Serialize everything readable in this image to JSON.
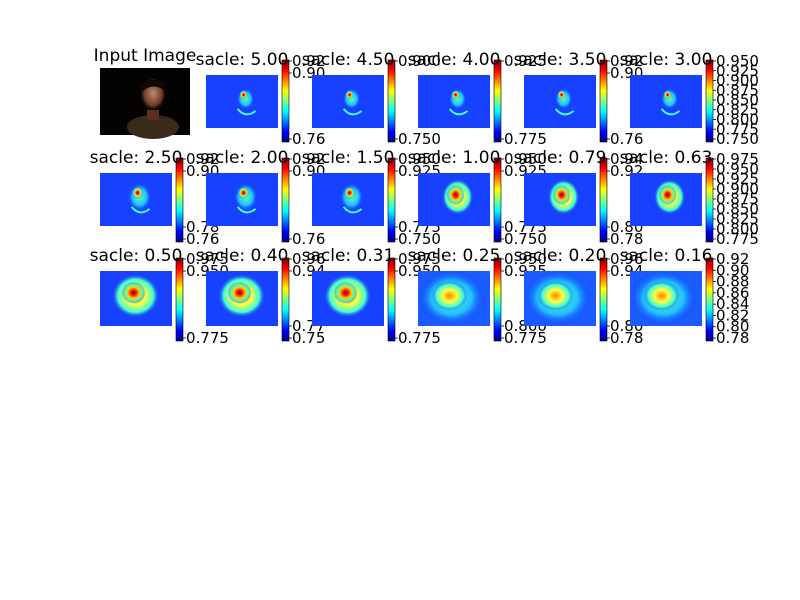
{
  "figure": {
    "input_title": "Input Image"
  },
  "colors": {
    "jet_low": "#00007f",
    "jet_mid": "#7fff7f",
    "jet_high": "#7f0000",
    "background": "#ffffff"
  },
  "chart_data": {
    "type": "heatmap",
    "colormap": "jet",
    "panels": [
      {
        "title": "sacle: 5.00",
        "cbar_ticks": [
          "0.92",
          "0.90",
          "0.76"
        ],
        "hotspot": "face-sparse"
      },
      {
        "title": "sacle: 4.50",
        "cbar_ticks": [
          "0.900",
          "0.750"
        ],
        "hotspot": "face-sparse"
      },
      {
        "title": "sacle: 4.00",
        "cbar_ticks": [
          "0.925",
          "0.775"
        ],
        "hotspot": "face-sparse"
      },
      {
        "title": "sacle: 3.50",
        "cbar_ticks": [
          "0.92",
          "0.90",
          "0.76"
        ],
        "hotspot": "face-sparse"
      },
      {
        "title": "sacle: 3.00",
        "cbar_ticks": [
          "0.950",
          "0.925",
          "0.900",
          "0.875",
          "0.850",
          "0.825",
          "0.800",
          "0.775",
          "0.750"
        ],
        "hotspot": "face-sparse"
      },
      {
        "title": "sacle: 2.50",
        "cbar_ticks": [
          "0.92",
          "0.90",
          "0.78",
          "0.76"
        ],
        "hotspot": "face-medium"
      },
      {
        "title": "sacle: 2.00",
        "cbar_ticks": [
          "0.92",
          "0.90",
          "0.76"
        ],
        "hotspot": "face-medium"
      },
      {
        "title": "sacle: 1.50",
        "cbar_ticks": [
          "0.950",
          "0.925",
          "0.775",
          "0.750"
        ],
        "hotspot": "face-medium"
      },
      {
        "title": "sacle: 1.00",
        "cbar_ticks": [
          "0.950",
          "0.925",
          "0.775",
          "0.750"
        ],
        "hotspot": "face-blob"
      },
      {
        "title": "sacle: 0.79",
        "cbar_ticks": [
          "0.94",
          "0.92",
          "0.80",
          "0.78"
        ],
        "hotspot": "face-blob"
      },
      {
        "title": "sacle: 0.63",
        "cbar_ticks": [
          "0.975",
          "0.950",
          "0.925",
          "0.900",
          "0.875",
          "0.850",
          "0.825",
          "0.800",
          "0.775"
        ],
        "hotspot": "face-blob"
      },
      {
        "title": "sacle: 0.50",
        "cbar_ticks": [
          "0.975",
          "0.950",
          "0.775"
        ],
        "hotspot": "blob-large"
      },
      {
        "title": "sacle: 0.40",
        "cbar_ticks": [
          "0.96",
          "0.94",
          "0.77",
          "0.75"
        ],
        "hotspot": "blob-large"
      },
      {
        "title": "sacle: 0.31",
        "cbar_ticks": [
          "0.975",
          "0.950",
          "0.775"
        ],
        "hotspot": "blob-large"
      },
      {
        "title": "sacle: 0.25",
        "cbar_ticks": [
          "0.950",
          "0.925",
          "0.800",
          "0.775"
        ],
        "hotspot": "blob-diffuse"
      },
      {
        "title": "sacle: 0.20",
        "cbar_ticks": [
          "0.96",
          "0.94",
          "0.80",
          "0.78"
        ],
        "hotspot": "blob-diffuse"
      },
      {
        "title": "sacle: 0.16",
        "cbar_ticks": [
          "0.92",
          "0.90",
          "0.88",
          "0.86",
          "0.84",
          "0.82",
          "0.80",
          "0.78"
        ],
        "hotspot": "blob-diffuse"
      }
    ]
  }
}
